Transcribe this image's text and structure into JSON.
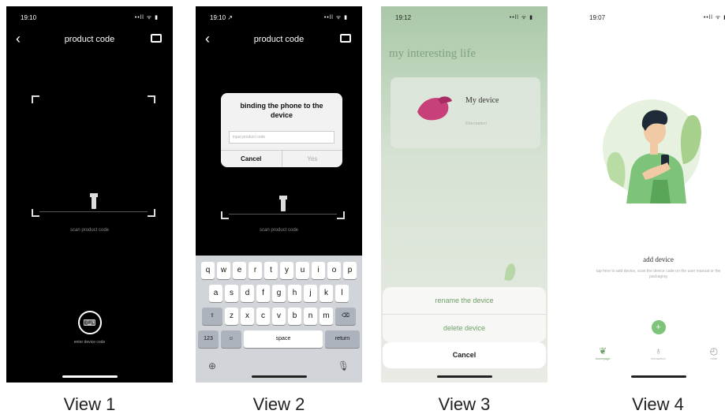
{
  "captions": [
    "View 1",
    "View 2",
    "View 3",
    "View 4"
  ],
  "view1": {
    "time": "19:10",
    "signal": "••ll ᯤ ▮",
    "nav_title": "product code",
    "scan_label": "scan product code",
    "enter_label": "enter device code"
  },
  "view2": {
    "time": "19:10 ↗",
    "signal": "••ll ᯤ ▮",
    "nav_title": "product code",
    "dialog_title": "binding the phone to the device",
    "dialog_placeholder": "input product code",
    "cancel": "Cancel",
    "confirm": "Yes",
    "scan_label": "scan product code",
    "keys_row1": [
      "q",
      "w",
      "e",
      "r",
      "t",
      "y",
      "u",
      "i",
      "o",
      "p"
    ],
    "keys_row2": [
      "a",
      "s",
      "d",
      "f",
      "g",
      "h",
      "j",
      "k",
      "l"
    ],
    "keys_row3": [
      "z",
      "x",
      "c",
      "v",
      "b",
      "n",
      "m"
    ],
    "key_123": "123",
    "key_space": "space",
    "key_return": "return"
  },
  "view3": {
    "time": "19:12",
    "signal": "••ll ᯤ ▮",
    "title": "my interesting life",
    "device_name": "My device",
    "device_status": "Disconnect",
    "rename": "rename the device",
    "delete": "delete device",
    "cancel": "Cancel"
  },
  "view4": {
    "time": "19:07",
    "signal": "••ll ᯤ ▮",
    "add_device": "add device",
    "add_hint": "tap here to add device, scan the device code on the user manual or the packaging",
    "plus": "+",
    "tabs": [
      "homepage",
      "interaction",
      "mine"
    ]
  }
}
